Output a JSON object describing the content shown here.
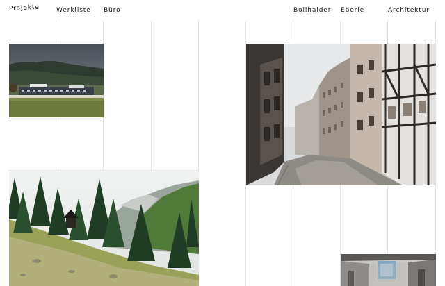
{
  "nav": {
    "left": {
      "logo": "Projekte",
      "werkliste": "Werkliste",
      "buero": "Büro"
    },
    "right": {
      "bollhalder": "Bollhalder",
      "eberle": "Eberle",
      "architektur": "Architektur"
    }
  },
  "projects": [
    {
      "scene": "building-in-valley-photo"
    },
    {
      "scene": "old-town-street-photo"
    },
    {
      "scene": "alpine-forest-meadow-photo"
    },
    {
      "scene": "interior-corridor-photo"
    }
  ],
  "colors": {
    "text": "#111111",
    "gridline": "#e6e6e6",
    "background": "#ffffff"
  }
}
